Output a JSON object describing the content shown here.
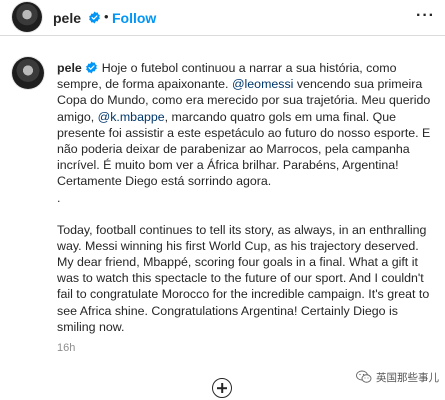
{
  "header": {
    "username": "pele",
    "separator": "•",
    "follow_label": "Follow",
    "more_label": "···"
  },
  "post": {
    "username": "pele",
    "caption_pt_1": " Hoje o futebol continuou a narrar a sua história, como sempre, de forma apaixonante. ",
    "mention_messi": "@leomessi",
    "caption_pt_2": " vencendo sua primeira Copa do Mundo, como era merecido por sua trajetória. Meu querido amigo, ",
    "mention_mbappe": "@k.mbappe",
    "caption_pt_3": ", marcando quatro gols em uma final. Que presente foi assistir a este espetáculo ao futuro do nosso esporte. E não poderia deixar de parabenizar ao Marrocos, pela campanha incrível. É muito bom ver a África brilhar. Parabéns, Argentina! Certamente Diego está sorrindo agora.",
    "separator_dot": ".",
    "caption_en": "Today, football continues to tell its story, as always, in an enthralling way. Messi winning his first World Cup, as his trajectory deserved. My dear friend, Mbappé, scoring four goals in a final. What a gift it was to watch this spectacle to the future of our sport. And I couldn't fail to congratulate Morocco for the incredible campaign. It's great to see Africa shine. Congratulations Argentina! Certainly Diego is smiling now.",
    "timestamp": "16h"
  },
  "watermark": {
    "text": "英国那些事儿"
  },
  "icons": {
    "verified": "verified-badge-icon",
    "more": "more-options-icon",
    "add": "add-circle-icon",
    "watermark": "wechat-logo-icon"
  },
  "colors": {
    "link_blue": "#0095f6",
    "mention": "#00376b",
    "verified": "#0095f6",
    "text": "#262626",
    "muted": "#8e8e8e"
  }
}
